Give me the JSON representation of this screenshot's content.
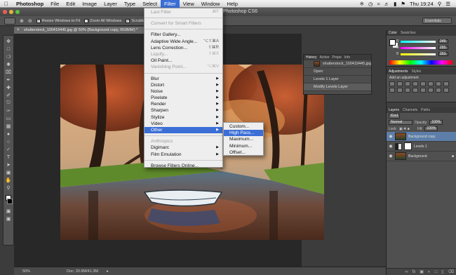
{
  "menubar": {
    "app": "Photoshop",
    "items": [
      "File",
      "Edit",
      "Image",
      "Layer",
      "Type",
      "Select",
      "Filter",
      "View",
      "Window",
      "Help"
    ],
    "active": "Filter",
    "clock": "Thu 19:24"
  },
  "window": {
    "title": "Photoshop CS6"
  },
  "options_bar": {
    "resize_label": "Resize Windows to Fit",
    "zoom_all_label": "Zoom All Windows",
    "scrubby_label": "Scrubby Zoom",
    "workspace": "Essentials"
  },
  "document": {
    "tab_title": "shutterstock_100419445.jpg @ 50% (Background copy, RGB/8#) *",
    "zoom": "50%",
    "doc_size": "Doc: 20.8M/41.3M"
  },
  "filter_menu": {
    "last_filter": {
      "label": "Last Filter",
      "shortcut": "⌘F"
    },
    "convert_smart": "Convert for Smart Filters",
    "filter_gallery": "Filter Gallery...",
    "adaptive_wide": {
      "label": "Adaptive Wide Angle...",
      "shortcut": "⌥⇧⌘A"
    },
    "lens_correction": {
      "label": "Lens Correction...",
      "shortcut": "⇧⌘R"
    },
    "liquify": {
      "label": "Liquify...",
      "shortcut": "⇧⌘X"
    },
    "oil_paint": "Oil Paint...",
    "vanishing_point": {
      "label": "Vanishing Point...",
      "shortcut": "⌥⌘V"
    },
    "submenus": [
      "Blur",
      "Distort",
      "Noise",
      "Pixelate",
      "Render",
      "Sharpen",
      "Stylize",
      "Video",
      "Other"
    ],
    "highlighted": "Other",
    "plugins_header": "Anthropics",
    "plugins": [
      "Digimarc",
      "Film Emulation"
    ],
    "browse_online": "Browse Filters Online..."
  },
  "other_submenu": {
    "items": [
      "Custom...",
      "High Pass...",
      "Maximum...",
      "Minimum...",
      "Offset..."
    ],
    "highlighted": "High Pass..."
  },
  "history_panel": {
    "tabs": [
      "History",
      "Action",
      "Prope",
      "Info"
    ],
    "snapshot": "shutterstock_100419445.jpg",
    "states": [
      "Open",
      "Levels 1 Layer",
      "Modify Levels Layer"
    ]
  },
  "color_panel": {
    "tabs": [
      "Color",
      "Swatches"
    ],
    "channels": [
      {
        "name": "R",
        "value": "249"
      },
      {
        "name": "G",
        "value": "255"
      },
      {
        "name": "B",
        "value": "253"
      }
    ]
  },
  "adjustments_panel": {
    "tabs": [
      "Adjustments",
      "Styles"
    ],
    "title": "Add an adjustment"
  },
  "layers_panel": {
    "tabs": [
      "Layers",
      "Channels",
      "Paths"
    ],
    "kind": "Kind",
    "blend": "Normal",
    "opacity_label": "Opacity:",
    "opacity": "100%",
    "lock_label": "Lock:",
    "fill_label": "Fill:",
    "fill": "100%",
    "layers": [
      {
        "name": "Background copy",
        "selected": true
      },
      {
        "name": "Levels 1",
        "selected": false
      },
      {
        "name": "Background",
        "selected": false
      }
    ]
  },
  "colors": {
    "menu_highlight": "#3b6fd6",
    "panel_bg": "#505050",
    "canvas_bg": "#282828"
  }
}
